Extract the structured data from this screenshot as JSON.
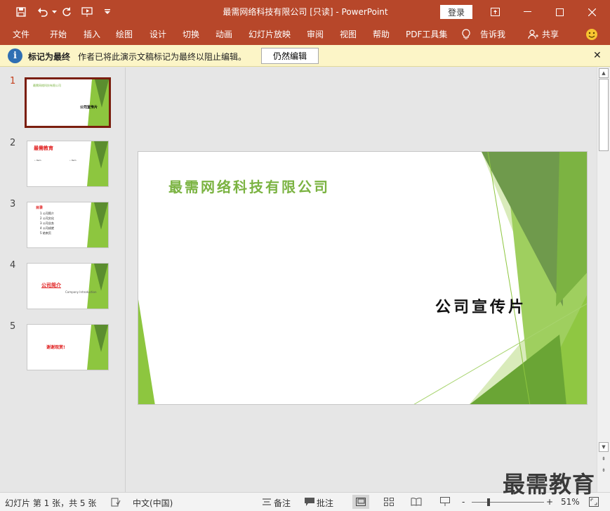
{
  "window": {
    "title": "最需网络科技有限公司 [只读]  -  PowerPoint",
    "login_label": "登录",
    "qat_icons": [
      "save-icon",
      "undo-icon",
      "redo-icon",
      "slideshow-from-start-icon",
      "customize-qat-icon"
    ],
    "window_icons": [
      "ribbon-display-options-icon",
      "minimize-icon",
      "maximize-icon",
      "close-icon"
    ]
  },
  "ribbon": {
    "tabs": [
      "文件",
      "开始",
      "插入",
      "绘图",
      "设计",
      "切换",
      "动画",
      "幻灯片放映",
      "审阅",
      "视图",
      "帮助",
      "PDF工具集"
    ],
    "tell_me": "告诉我",
    "share": "共享",
    "accent_color": "#b7472a"
  },
  "infobar": {
    "title": "标记为最终",
    "message": "作者已将此演示文稿标记为最终以阻止编辑。",
    "button": "仍然编辑"
  },
  "thumbnails": [
    {
      "number": "1",
      "texts": [
        "最需网络科技有限公司",
        "公司宣传片"
      ]
    },
    {
      "number": "2",
      "texts": [
        "最需教育",
        "• Item",
        "• Item"
      ]
    },
    {
      "number": "3",
      "texts": [
        "目录",
        "1 公司简介",
        "2 公司文化",
        "3 公司业务",
        "4 公司成就",
        "5 结束页"
      ]
    },
    {
      "number": "4",
      "texts": [
        "公司简介",
        "Company Introduction"
      ]
    },
    {
      "number": "5",
      "texts": [
        "谢谢观赏!"
      ]
    }
  ],
  "slide": {
    "company": "最需网络科技有限公司",
    "subtitle": "公司宣传片",
    "accent_green": "#7bb342"
  },
  "statusbar": {
    "slide_info": "幻灯片 第 1 张，共 5 张",
    "language": "中文(中国)",
    "notes": "备注",
    "comments": "批注",
    "zoom_minus": "-",
    "zoom_plus": "+",
    "zoom": "51%"
  },
  "watermark": "最需教育"
}
